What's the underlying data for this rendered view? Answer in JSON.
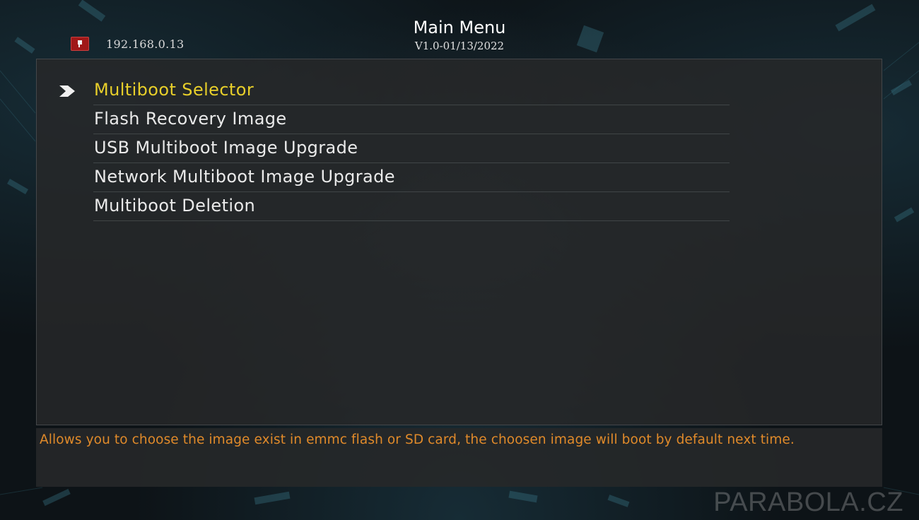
{
  "header": {
    "title": "Main Menu",
    "version": "V1.0-01/13/2022",
    "ip_address": "192.168.0.13",
    "network_icon": "network-status-icon"
  },
  "menu": {
    "items": [
      {
        "label": "Multiboot Selector",
        "selected": true
      },
      {
        "label": "Flash Recovery Image",
        "selected": false
      },
      {
        "label": "USB Multiboot Image Upgrade",
        "selected": false
      },
      {
        "label": "Network Multiboot Image Upgrade",
        "selected": false
      },
      {
        "label": "Multiboot Deletion",
        "selected": false
      }
    ],
    "cursor_icon": "chevron-right-icon"
  },
  "description": {
    "text": "Allows you to choose the image exist in emmc flash or SD card, the choosen image will boot by default next time."
  },
  "watermark": "PARABOLA.CZ",
  "colors": {
    "selected_text": "#e8cf2a",
    "normal_text": "#eaeaea",
    "description_text": "#e08a2a",
    "network_icon": "#a01818"
  }
}
